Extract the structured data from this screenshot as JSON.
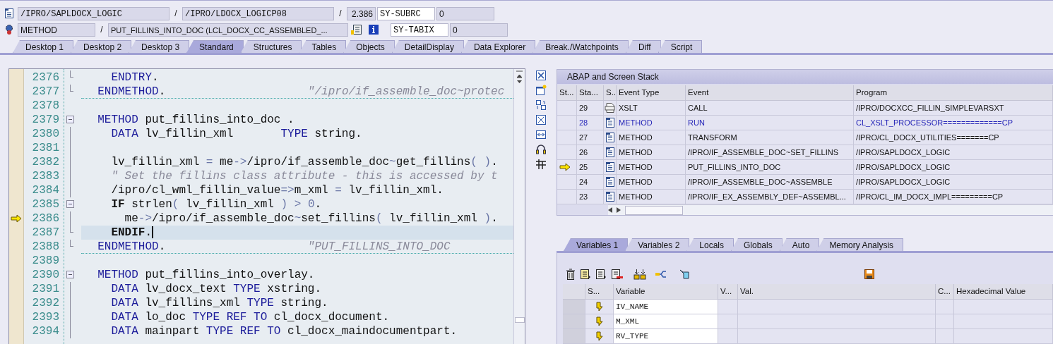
{
  "header_rows": [
    {
      "items": [
        {
          "kind": "name",
          "text": "/IPRO/SAPLDOCX_LOGIC"
        },
        {
          "kind": "sep",
          "text": "/"
        },
        {
          "kind": "name",
          "text": "/IPRO/LDOCX_LOGICP08"
        },
        {
          "kind": "sep",
          "text": "/"
        },
        {
          "kind": "number",
          "text": "2.386"
        },
        {
          "kind": "sysname",
          "text": "SY-SUBRC"
        },
        {
          "kind": "sysvalue",
          "text": "0"
        }
      ]
    },
    {
      "items": [
        {
          "kind": "type",
          "text": "METHOD"
        },
        {
          "kind": "sep",
          "text": "/"
        },
        {
          "kind": "long",
          "text": "PUT_FILLINS_INTO_DOC (LCL_DOCX_CC_ASSEMBLED_..."
        },
        {
          "kind": "tools"
        },
        {
          "kind": "sysname",
          "text": "SY-TABIX"
        },
        {
          "kind": "sysvalue",
          "text": "0"
        }
      ]
    }
  ],
  "tabs": [
    {
      "label": "Desktop 1",
      "selected": false
    },
    {
      "label": "Desktop 2",
      "selected": false
    },
    {
      "label": "Desktop 3",
      "selected": false
    },
    {
      "label": "Standard",
      "selected": true
    },
    {
      "label": "Structures",
      "selected": false
    },
    {
      "label": "Tables",
      "selected": false
    },
    {
      "label": "Objects",
      "selected": false
    },
    {
      "label": "DetailDisplay",
      "selected": false
    },
    {
      "label": "Data Explorer",
      "selected": false
    },
    {
      "label": "Break./Watchpoints",
      "selected": false
    },
    {
      "label": "Diff",
      "selected": false
    },
    {
      "label": "Script",
      "selected": false
    }
  ],
  "editor": {
    "lines": [
      {
        "number": "2376",
        "kind": "end",
        "current": false,
        "cursor": false,
        "separator": false,
        "tokens": [
          {
            "text": "    ENDTRY",
            "kind": "keyword"
          },
          {
            "text": ".",
            "kind": "plain"
          }
        ]
      },
      {
        "number": "2377",
        "kind": "end",
        "current": false,
        "cursor": false,
        "separator": true,
        "tokens": [
          {
            "text": "  ENDMETHOD",
            "kind": "keyword"
          },
          {
            "text": ".",
            "kind": "plain"
          },
          {
            "text": "                     \"/ipro/if_assemble_doc~protec",
            "kind": "comment"
          }
        ]
      },
      {
        "number": "2378",
        "kind": "gap",
        "current": false,
        "cursor": false,
        "separator": false
      },
      {
        "number": "2379",
        "kind": "start",
        "current": false,
        "cursor": false,
        "separator": false,
        "tokens": [
          {
            "text": "  METHOD",
            "kind": "keyword"
          },
          {
            "text": " put_fillins_into_doc .",
            "kind": "plain"
          }
        ]
      },
      {
        "number": "2380",
        "kind": "body",
        "current": false,
        "cursor": false,
        "separator": false,
        "tokens": [
          {
            "text": "    DATA",
            "kind": "keyword"
          },
          {
            "text": " lv_fillin_xml       ",
            "kind": "plain"
          },
          {
            "text": "TYPE",
            "kind": "keyword"
          },
          {
            "text": " string.",
            "kind": "plain"
          }
        ]
      },
      {
        "number": "2381",
        "kind": "body",
        "current": false,
        "cursor": false,
        "separator": false
      },
      {
        "number": "2382",
        "kind": "body",
        "current": false,
        "cursor": false,
        "separator": false,
        "tokens": [
          {
            "text": "    lv_fillin_xml ",
            "kind": "plain"
          },
          {
            "text": "=",
            "kind": "operator"
          },
          {
            "text": " me",
            "kind": "plain"
          },
          {
            "text": "->",
            "kind": "operator"
          },
          {
            "text": "/ipro/if_assemble_doc",
            "kind": "plain"
          },
          {
            "text": "~",
            "kind": "operator"
          },
          {
            "text": "get_fillins",
            "kind": "plain"
          },
          {
            "text": "( )",
            "kind": "operator"
          },
          {
            "text": ".",
            "kind": "plain"
          }
        ]
      },
      {
        "number": "2383",
        "kind": "body",
        "current": false,
        "cursor": false,
        "separator": false,
        "tokens": [
          {
            "text": "    \" Set the fillins class attribute - this is accessed by t",
            "kind": "comment"
          }
        ]
      },
      {
        "number": "2384",
        "kind": "body",
        "current": false,
        "cursor": false,
        "separator": false,
        "tokens": [
          {
            "text": "    /ipro/cl_wml_fillin_value",
            "kind": "plain"
          },
          {
            "text": "=>",
            "kind": "operator"
          },
          {
            "text": "m_xml ",
            "kind": "plain"
          },
          {
            "text": "=",
            "kind": "operator"
          },
          {
            "text": " lv_fillin_xml.",
            "kind": "plain"
          }
        ]
      },
      {
        "number": "2385",
        "kind": "start",
        "current": false,
        "cursor": false,
        "separator": false,
        "tokens": [
          {
            "text": "    IF",
            "kind": "strong"
          },
          {
            "text": " strlen",
            "kind": "plain"
          },
          {
            "text": "(",
            "kind": "operator"
          },
          {
            "text": " lv_fillin_xml ",
            "kind": "plain"
          },
          {
            "text": ") > 0",
            "kind": "operator"
          },
          {
            "text": ".",
            "kind": "plain"
          }
        ]
      },
      {
        "number": "2386",
        "kind": "body",
        "current": true,
        "cursor": false,
        "separator": false,
        "tokens": [
          {
            "text": "      me",
            "kind": "plain"
          },
          {
            "text": "->",
            "kind": "operator"
          },
          {
            "text": "/ipro/if_assemble_doc",
            "kind": "plain"
          },
          {
            "text": "~",
            "kind": "operator"
          },
          {
            "text": "set_fillins",
            "kind": "plain"
          },
          {
            "text": "(",
            "kind": "operator"
          },
          {
            "text": " lv_fillin_xml ",
            "kind": "plain"
          },
          {
            "text": ")",
            "kind": "operator"
          },
          {
            "text": ".",
            "kind": "plain"
          }
        ]
      },
      {
        "number": "2387",
        "kind": "end",
        "current": false,
        "cursor": true,
        "separator": false,
        "tokens": [
          {
            "text": "    ENDIF",
            "kind": "strong"
          },
          {
            "text": ".",
            "kind": "plain"
          }
        ]
      },
      {
        "number": "2388",
        "kind": "end",
        "current": false,
        "cursor": false,
        "separator": true,
        "tokens": [
          {
            "text": "  ENDMETHOD",
            "kind": "keyword"
          },
          {
            "text": ".",
            "kind": "plain"
          },
          {
            "text": "                     \"PUT_FILLINS_INTO_DOC",
            "kind": "comment"
          }
        ]
      },
      {
        "number": "2389",
        "kind": "gap",
        "current": false,
        "cursor": false,
        "separator": false
      },
      {
        "number": "2390",
        "kind": "start",
        "current": false,
        "cursor": false,
        "separator": false,
        "tokens": [
          {
            "text": "  METHOD",
            "kind": "keyword"
          },
          {
            "text": " put_fillins_into_overlay.",
            "kind": "plain"
          }
        ]
      },
      {
        "number": "2391",
        "kind": "body",
        "current": false,
        "cursor": false,
        "separator": false,
        "tokens": [
          {
            "text": "    DATA",
            "kind": "keyword"
          },
          {
            "text": " lv_docx_text ",
            "kind": "plain"
          },
          {
            "text": "TYPE",
            "kind": "keyword"
          },
          {
            "text": " xstring.",
            "kind": "plain"
          }
        ]
      },
      {
        "number": "2392",
        "kind": "body",
        "current": false,
        "cursor": false,
        "separator": false,
        "tokens": [
          {
            "text": "    DATA",
            "kind": "keyword"
          },
          {
            "text": " lv_fillins_xml ",
            "kind": "plain"
          },
          {
            "text": "TYPE",
            "kind": "keyword"
          },
          {
            "text": " string.",
            "kind": "plain"
          }
        ]
      },
      {
        "number": "2393",
        "kind": "body",
        "current": false,
        "cursor": false,
        "separator": false,
        "tokens": [
          {
            "text": "    DATA",
            "kind": "keyword"
          },
          {
            "text": " lo_doc ",
            "kind": "plain"
          },
          {
            "text": "TYPE REF TO",
            "kind": "keyword"
          },
          {
            "text": " cl_docx_document.",
            "kind": "plain"
          }
        ]
      },
      {
        "number": "2394",
        "kind": "body",
        "current": false,
        "cursor": false,
        "separator": false,
        "tokens": [
          {
            "text": "    DATA",
            "kind": "keyword"
          },
          {
            "text": " mainpart ",
            "kind": "plain"
          },
          {
            "text": "TYPE REF TO",
            "kind": "keyword"
          },
          {
            "text": " cl_docx_maindocumentpart.",
            "kind": "plain"
          }
        ]
      }
    ]
  },
  "stack": {
    "title": "ABAP and Screen Stack",
    "columns": [
      "St...",
      "Sta...",
      "S..",
      "Event Type",
      "Event",
      "Program"
    ],
    "rows": [
      {
        "level": "29",
        "kind": "xslt",
        "event_type": "XSLT",
        "event": "CALL",
        "program": "/IPRO/DOCXCC_FILLIN_SIMPLEVARSXT",
        "current": false,
        "highlighted": false
      },
      {
        "level": "28",
        "kind": "method",
        "event_type": "METHOD",
        "event": "RUN",
        "program": "CL_XSLT_PROCESSOR=============CP",
        "current": false,
        "highlighted": true
      },
      {
        "level": "27",
        "kind": "method",
        "event_type": "METHOD",
        "event": "TRANSFORM",
        "program": "/IPRO/CL_DOCX_UTILITIES=======CP",
        "current": false,
        "highlighted": false
      },
      {
        "level": "26",
        "kind": "method",
        "event_type": "METHOD",
        "event": "/IPRO/IF_ASSEMBLE_DOC~SET_FILLINS",
        "program": "/IPRO/SAPLDOCX_LOGIC",
        "current": false,
        "highlighted": false
      },
      {
        "level": "25",
        "kind": "method",
        "event_type": "METHOD",
        "event": "PUT_FILLINS_INTO_DOC",
        "program": "/IPRO/SAPLDOCX_LOGIC",
        "current": true,
        "highlighted": false
      },
      {
        "level": "24",
        "kind": "method",
        "event_type": "METHOD",
        "event": "/IPRO/IF_ASSEMBLE_DOC~ASSEMBLE",
        "program": "/IPRO/SAPLDOCX_LOGIC",
        "current": false,
        "highlighted": false
      },
      {
        "level": "23",
        "kind": "method",
        "event_type": "METHOD",
        "event": "/IPRO/IF_EX_ASSEMBLY_DEF~ASSEMBL...",
        "program": "/IPRO/CL_IM_DOCX_IMPL=========CP",
        "current": false,
        "highlighted": false
      }
    ]
  },
  "variable_tabs": [
    {
      "label": "Variables 1",
      "selected": true
    },
    {
      "label": "Variables 2",
      "selected": false
    },
    {
      "label": "Locals",
      "selected": false
    },
    {
      "label": "Globals",
      "selected": false
    },
    {
      "label": "Auto",
      "selected": false
    },
    {
      "label": "Memory Analysis",
      "selected": false
    }
  ],
  "variables": {
    "columns": [
      "S...",
      "Variable",
      "V...",
      "Val.",
      "C...",
      "Hexadecimal Value"
    ],
    "rows": [
      {
        "name": "IV_NAME"
      },
      {
        "name": "M_XML"
      },
      {
        "name": "RV_TYPE"
      }
    ]
  }
}
